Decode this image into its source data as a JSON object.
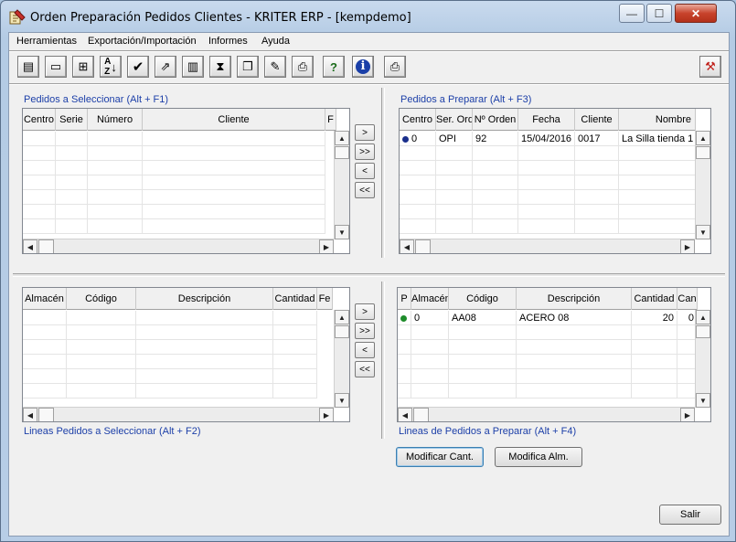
{
  "window": {
    "title": "Orden Preparación Pedidos Clientes - KRITER ERP - [kempdemo]",
    "minimize": "—",
    "maximize": "☐",
    "close": "✕"
  },
  "menu": [
    "Herramientas",
    "Exportación/Importación",
    "Informes",
    "Ayuda"
  ],
  "toolbar": {
    "icons": [
      "form-icon",
      "window-icon",
      "tree-icon",
      "sort-az-icon",
      "check-icon",
      "folder-export-icon",
      "documents-icon",
      "filter-icon",
      "windows-icon",
      "edit-document-icon",
      "printer-icon",
      "help-icon",
      "info-icon",
      "print-icon"
    ],
    "glyphs": [
      "▤",
      "▭",
      "⊞",
      "↓",
      "✔",
      "⇗",
      "▥",
      "⧗",
      "❐",
      "✎",
      "⎙",
      "?",
      "i",
      "⎙"
    ],
    "exit_glyph": "⚒"
  },
  "pedidos_seleccionar": {
    "title": "Pedidos a Seleccionar  (Alt + F1)",
    "columns": [
      "Centro",
      "Serie",
      "Número",
      "Cliente",
      "F"
    ]
  },
  "pedidos_preparar": {
    "title": "Pedidos a Preparar  (Alt + F3)",
    "columns": [
      "Centro",
      "Ser. Ord",
      "Nº Orden",
      "Fecha",
      "Cliente",
      "Nombre"
    ],
    "rows": [
      {
        "centro": "0",
        "ser_ord": "OPI",
        "num_orden": "92",
        "fecha": "15/04/2016",
        "cliente": "0017",
        "nombre": "La Silla tienda 1",
        "dot_color": "#1a2f8c"
      }
    ]
  },
  "lineas_seleccionar": {
    "title": "Lineas Pedidos a Seleccionar  (Alt + F2)",
    "columns": [
      "Almacén",
      "Código",
      "Descripción",
      "Cantidad",
      "Fe"
    ]
  },
  "lineas_preparar": {
    "title": "Lineas de Pedidos a Preparar  (Alt + F4)",
    "columns": [
      "P",
      "Almacén",
      "Código",
      "Descripción",
      "Cantidad",
      "Can"
    ],
    "rows": [
      {
        "almacen": "0",
        "codigo": "AA08",
        "descripcion": "ACERO 08",
        "cantidad": "20",
        "can": "0",
        "dot_color": "#1e8c2a"
      }
    ]
  },
  "move_buttons": [
    ">",
    ">>",
    "<",
    "<<"
  ],
  "buttons": {
    "modificar_cant": "Modificar Cant.",
    "modifica_alm": "Modifica Alm.",
    "salir": "Salir"
  }
}
